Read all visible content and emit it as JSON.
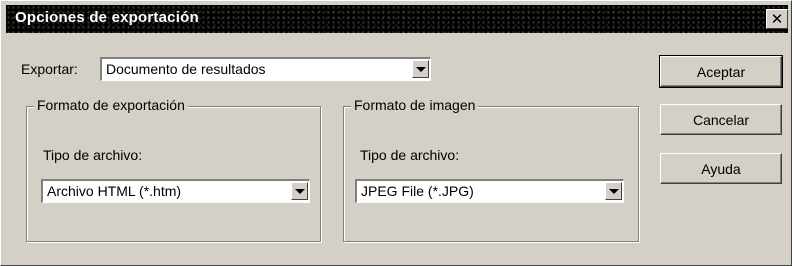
{
  "dialog": {
    "title": "Opciones de exportación",
    "close_label": "✕"
  },
  "export": {
    "label": "Exportar:",
    "value": "Documento de resultados"
  },
  "export_format": {
    "group_title": "Formato de exportación",
    "file_type_label": "Tipo de archivo:",
    "file_type_value": "Archivo HTML (*.htm)"
  },
  "image_format": {
    "group_title": "Formato de imagen",
    "file_type_label": "Tipo de archivo:",
    "file_type_value": "JPEG File (*.JPG)"
  },
  "buttons": {
    "accept": "Aceptar",
    "cancel": "Cancelar",
    "help": "Ayuda"
  }
}
